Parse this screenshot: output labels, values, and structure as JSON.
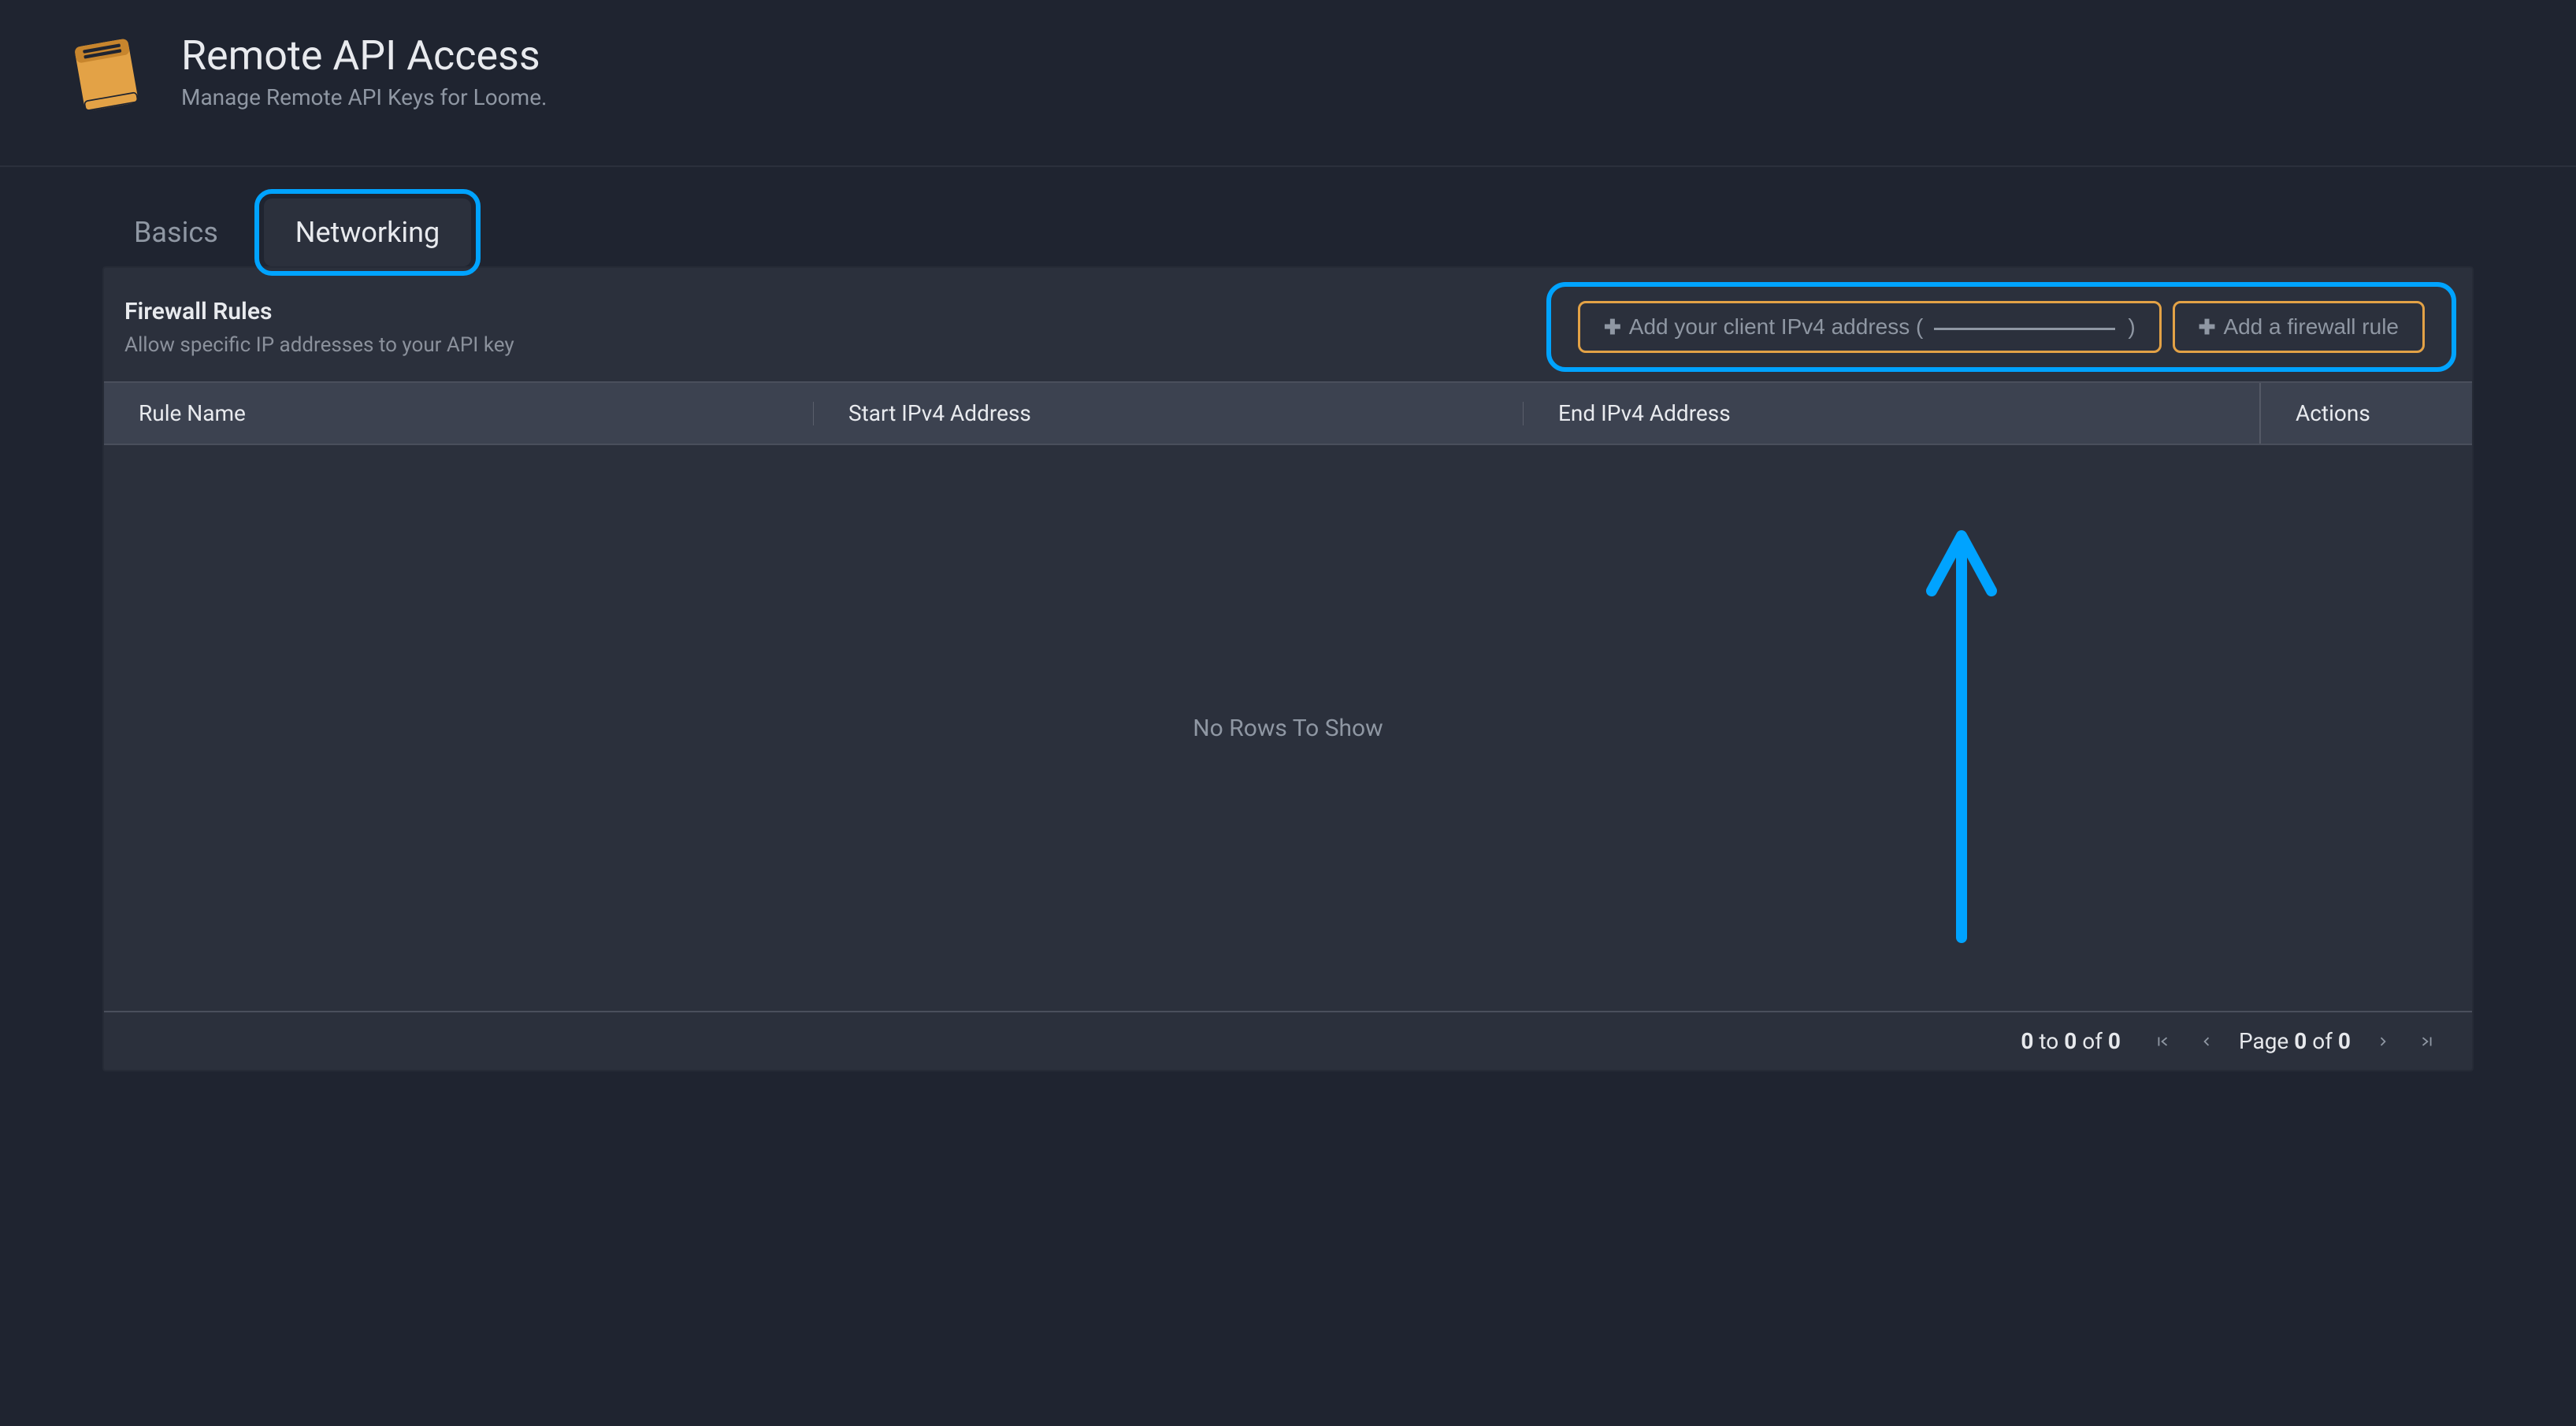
{
  "header": {
    "title": "Remote API Access",
    "subtitle": "Manage Remote API Keys for Loome."
  },
  "tabs": {
    "basics": "Basics",
    "networking": "Networking"
  },
  "panel": {
    "title": "Firewall Rules",
    "subtitle": "Allow specific IP addresses to your API key"
  },
  "actions": {
    "add_client_prefix": "Add your client IPv4 address (",
    "add_client_suffix": ")",
    "add_firewall_rule": "Add a firewall rule"
  },
  "table": {
    "columns": {
      "rule": "Rule Name",
      "start": "Start IPv4 Address",
      "end": "End IPv4 Address",
      "actions": "Actions"
    },
    "empty": "No Rows To Show"
  },
  "pager": {
    "from": "0",
    "to_word": "to",
    "to": "0",
    "of_word": "of",
    "total": "0",
    "page_word": "Page",
    "page": "0",
    "pages": "0"
  },
  "colors": {
    "accent_orange": "#e3a246",
    "highlight_blue": "#00a3ff"
  }
}
